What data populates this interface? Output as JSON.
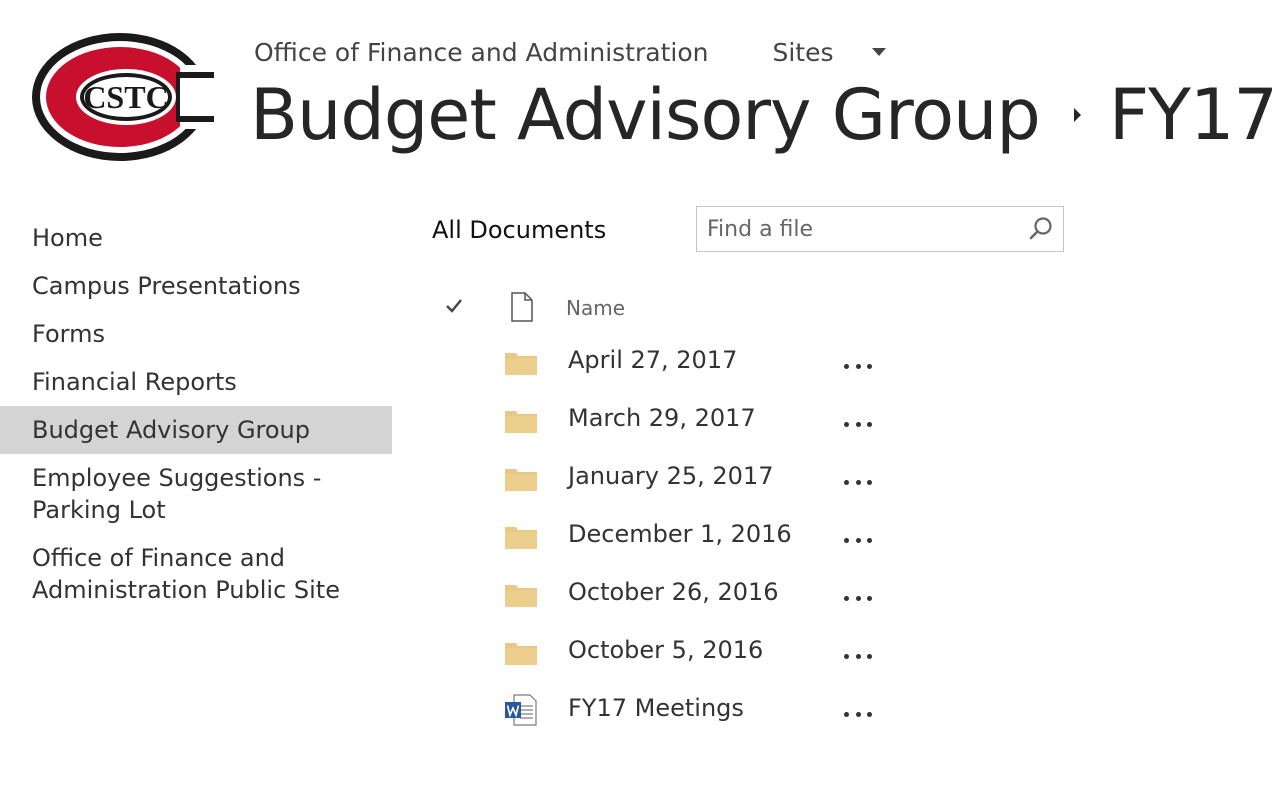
{
  "header": {
    "parent_site": "Office of Finance and Administration",
    "sites_label": "Sites",
    "site_title": "Budget Advisory Group",
    "current_folder": "FY17",
    "logo_text": "CSTC"
  },
  "quicklaunch": {
    "items": [
      {
        "label": "Home"
      },
      {
        "label": "Campus Presentations"
      },
      {
        "label": "Forms"
      },
      {
        "label": "Financial Reports"
      },
      {
        "label": "Budget Advisory Group",
        "selected": true
      },
      {
        "label": "Employee Suggestions - Parking Lot"
      },
      {
        "label": "Office of Finance and Administration Public Site"
      }
    ]
  },
  "library": {
    "view_title": "All Documents",
    "search_placeholder": "Find a file",
    "name_column": "Name",
    "items": [
      {
        "name": "April 27, 2017",
        "type": "folder"
      },
      {
        "name": "March 29, 2017",
        "type": "folder"
      },
      {
        "name": "January 25, 2017",
        "type": "folder"
      },
      {
        "name": "December 1, 2016",
        "type": "folder"
      },
      {
        "name": "October 26, 2016",
        "type": "folder"
      },
      {
        "name": "October 5, 2016",
        "type": "folder"
      },
      {
        "name": "FY17 Meetings",
        "type": "word-document"
      }
    ]
  },
  "colors": {
    "logo_red": "#c8102e",
    "folder": "#e8c885",
    "selected_nav": "#d4d4d4",
    "word_blue": "#2b579a"
  },
  "icons": {
    "check": "checkmark-icon",
    "file_type": "document-icon",
    "folder": "folder-icon",
    "word": "word-document-icon",
    "search": "magnifier-icon",
    "more": "ellipsis-icon"
  }
}
